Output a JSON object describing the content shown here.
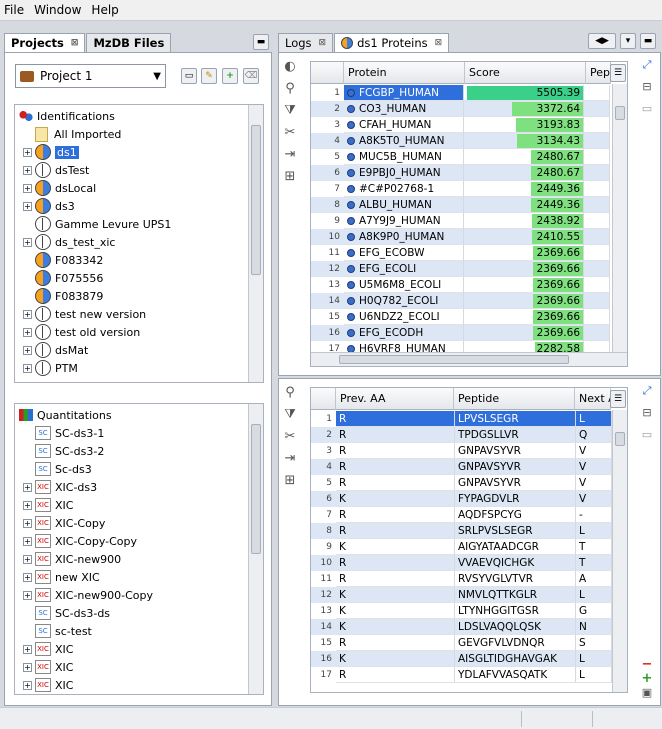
{
  "menu": [
    "File",
    "Window",
    "Help"
  ],
  "left_tabs": [
    {
      "label": "Projects",
      "closable": true
    },
    {
      "label": "MzDB Files",
      "closable": false
    }
  ],
  "project_select": {
    "value": "Project 1"
  },
  "identifications": {
    "root_label": "Identifications",
    "items": [
      {
        "label": "All Imported",
        "icon": "document-icon",
        "toggle": false
      },
      {
        "label": "ds1",
        "icon": "merged-dataset-icon",
        "toggle": true,
        "selected": true
      },
      {
        "label": "dsTest",
        "icon": "dataset-icon",
        "toggle": true
      },
      {
        "label": "dsLocal",
        "icon": "merged-dataset-icon",
        "toggle": true
      },
      {
        "label": "ds3",
        "icon": "merged-dataset-icon",
        "toggle": true
      },
      {
        "label": "Gamme Levure UPS1",
        "icon": "dataset-icon",
        "toggle": false
      },
      {
        "label": "ds_test_xic",
        "icon": "dataset-icon",
        "toggle": true
      },
      {
        "label": "F083342",
        "icon": "identified-dataset-icon",
        "toggle": false
      },
      {
        "label": "F075556",
        "icon": "identified-dataset-icon",
        "toggle": false
      },
      {
        "label": "F083879",
        "icon": "identified-dataset-icon",
        "toggle": false
      },
      {
        "label": "test new version",
        "icon": "dataset-icon",
        "toggle": true
      },
      {
        "label": "test old version",
        "icon": "dataset-icon",
        "toggle": true
      },
      {
        "label": "dsMat",
        "icon": "dataset-icon",
        "toggle": true
      },
      {
        "label": "PTM",
        "icon": "dataset-icon",
        "toggle": true
      }
    ]
  },
  "quantitations": {
    "root_label": "Quantitations",
    "items": [
      {
        "label": "SC-ds3-1",
        "icon": "sc-icon",
        "toggle": false
      },
      {
        "label": "SC-ds3-2",
        "icon": "sc-icon",
        "toggle": false
      },
      {
        "label": "Sc-ds3",
        "icon": "sc-icon",
        "toggle": false
      },
      {
        "label": "XIC-ds3",
        "icon": "xic-icon",
        "toggle": true
      },
      {
        "label": "XIC",
        "icon": "xic-icon",
        "toggle": true
      },
      {
        "label": "XIC-Copy",
        "icon": "xic-icon",
        "toggle": true
      },
      {
        "label": "XIC-Copy-Copy",
        "icon": "xic-icon",
        "toggle": true
      },
      {
        "label": "XIC-new900",
        "icon": "xic-icon",
        "toggle": true
      },
      {
        "label": "new  XIC",
        "icon": "xic-icon",
        "toggle": true
      },
      {
        "label": "XIC-new900-Copy",
        "icon": "xic-icon",
        "toggle": true
      },
      {
        "label": "SC-ds3-ds",
        "icon": "sc-icon",
        "toggle": false
      },
      {
        "label": "sc-test",
        "icon": "sc-icon",
        "toggle": false
      },
      {
        "label": "XIC",
        "icon": "xic-icon",
        "toggle": true
      },
      {
        "label": "XIC",
        "icon": "xic-icon",
        "toggle": true
      },
      {
        "label": "XIC",
        "icon": "xic-icon",
        "toggle": true
      }
    ]
  },
  "right_tabs": [
    {
      "label": "Logs",
      "closable": true
    },
    {
      "label": "ds1 Proteins",
      "closable": true,
      "active": true
    }
  ],
  "protein_table": {
    "columns": [
      "Protein",
      "Score",
      "Pep"
    ],
    "score_max": 5505.39,
    "rows": [
      {
        "n": "1",
        "protein": "FCGBP_HUMAN",
        "score": "5505.39",
        "v": 5505.39
      },
      {
        "n": "2",
        "protein": "CO3_HUMAN",
        "score": "3372.64",
        "v": 3372.64
      },
      {
        "n": "3",
        "protein": "CFAH_HUMAN",
        "score": "3193.83",
        "v": 3193.83
      },
      {
        "n": "4",
        "protein": "A8K5T0_HUMAN",
        "score": "3134.43",
        "v": 3134.43
      },
      {
        "n": "5",
        "protein": "MUC5B_HUMAN",
        "score": "2480.67",
        "v": 2480.67
      },
      {
        "n": "6",
        "protein": "E9PBJ0_HUMAN",
        "score": "2480.67",
        "v": 2480.67
      },
      {
        "n": "7",
        "protein": "#C#P02768-1",
        "score": "2449.36",
        "v": 2449.36
      },
      {
        "n": "8",
        "protein": "ALBU_HUMAN",
        "score": "2449.36",
        "v": 2449.36
      },
      {
        "n": "9",
        "protein": "A7Y9J9_HUMAN",
        "score": "2438.92",
        "v": 2438.92
      },
      {
        "n": "10",
        "protein": "A8K9P0_HUMAN",
        "score": "2410.55",
        "v": 2410.55
      },
      {
        "n": "11",
        "protein": "EFG_ECOBW",
        "score": "2369.66",
        "v": 2369.66
      },
      {
        "n": "12",
        "protein": "EFG_ECOLI",
        "score": "2369.66",
        "v": 2369.66
      },
      {
        "n": "13",
        "protein": "U5M6M8_ECOLI",
        "score": "2369.66",
        "v": 2369.66
      },
      {
        "n": "14",
        "protein": "H0Q782_ECOLI",
        "score": "2369.66",
        "v": 2369.66
      },
      {
        "n": "15",
        "protein": "U6NDZ2_ECOLI",
        "score": "2369.66",
        "v": 2369.66
      },
      {
        "n": "16",
        "protein": "EFG_ECODH",
        "score": "2369.66",
        "v": 2369.66
      },
      {
        "n": "17",
        "protein": "H6VRF8_HUMAN",
        "score": "2282.58",
        "v": 2282.58
      }
    ]
  },
  "peptide_table": {
    "columns": [
      "Prev. AA",
      "Peptide",
      "Next A"
    ],
    "rows": [
      {
        "n": "1",
        "prev": "R",
        "pep": "LPVSLSEGR",
        "next": "L"
      },
      {
        "n": "2",
        "prev": "R",
        "pep": "TPDGSLLVR",
        "next": "Q"
      },
      {
        "n": "3",
        "prev": "R",
        "pep": "GNPAVSYVR",
        "next": "V"
      },
      {
        "n": "4",
        "prev": "R",
        "pep": "GNPAVSYVR",
        "next": "V"
      },
      {
        "n": "5",
        "prev": "R",
        "pep": "GNPAVSYVR",
        "next": "V"
      },
      {
        "n": "6",
        "prev": "K",
        "pep": "FYPAGDVLR",
        "next": "V"
      },
      {
        "n": "7",
        "prev": "R",
        "pep": "AQDFSPCYG",
        "next": "-"
      },
      {
        "n": "8",
        "prev": "R",
        "pep": "SRLPVSLSEGR",
        "next": "L"
      },
      {
        "n": "9",
        "prev": "K",
        "pep": "AIGYATAADCGR",
        "next": "T"
      },
      {
        "n": "10",
        "prev": "R",
        "pep": "VVAEVQICHGK",
        "next": "T"
      },
      {
        "n": "11",
        "prev": "R",
        "pep": "RVSYVGLVTVR",
        "next": "A"
      },
      {
        "n": "12",
        "prev": "K",
        "pep": "NMVLQTTKGLR",
        "next": "L"
      },
      {
        "n": "13",
        "prev": "K",
        "pep": "LTYNHGGITGSR",
        "next": "G"
      },
      {
        "n": "14",
        "prev": "K",
        "pep": "LDSLVAQQLQSK",
        "next": "N"
      },
      {
        "n": "15",
        "prev": "R",
        "pep": "GEVGFVLVDNQR",
        "next": "S"
      },
      {
        "n": "16",
        "prev": "K",
        "pep": "AISGLTIDGHAVGAK",
        "next": "L"
      },
      {
        "n": "17",
        "prev": "R",
        "pep": "YDLAFVVASQATK",
        "next": "L"
      }
    ]
  },
  "colors": {
    "selection": "#2f6fdc",
    "score_bar": "#7ee07e",
    "row_alt": "#dde6f4"
  }
}
